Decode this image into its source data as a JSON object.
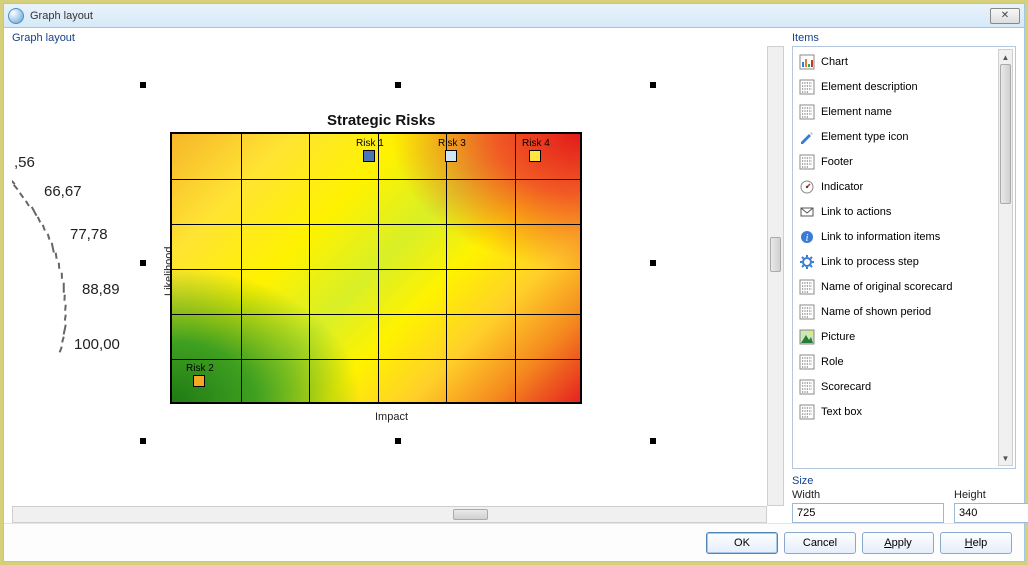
{
  "window": {
    "title": "Graph layout"
  },
  "panel": {
    "label": "Graph layout"
  },
  "gauge": {
    "labels": [
      ",56",
      "66,67",
      "77,78",
      "88,89",
      "100,00"
    ]
  },
  "chart": {
    "title": "Strategic Risks",
    "x_axis": "Impact",
    "y_axis": "Likelihood"
  },
  "chart_data": {
    "type": "heatmap",
    "title": "Strategic Risks",
    "xlabel": "Impact",
    "ylabel": "Likelihood",
    "grid": {
      "cols": 6,
      "rows": 6
    },
    "color_scale": [
      "green",
      "yellow",
      "orange",
      "red"
    ],
    "markers": [
      {
        "name": "Risk 1",
        "col": 3,
        "row": 1,
        "color": "#4a76b8"
      },
      {
        "name": "Risk 3",
        "col": 4,
        "row": 1,
        "color": "#cfe4f5"
      },
      {
        "name": "Risk 4",
        "col": 5.5,
        "row": 1,
        "color": "#ffe640"
      },
      {
        "name": "Risk 2",
        "col": 1,
        "row": 6,
        "color": "#f5a623"
      }
    ]
  },
  "items_panel": {
    "label": "Items",
    "list": [
      {
        "label": "Chart",
        "icon": "chart-icon"
      },
      {
        "label": "Element description",
        "icon": "text-grid-icon"
      },
      {
        "label": "Element name",
        "icon": "text-grid-icon"
      },
      {
        "label": "Element type icon",
        "icon": "pencil-icon"
      },
      {
        "label": "Footer",
        "icon": "text-grid-icon"
      },
      {
        "label": "Indicator",
        "icon": "gauge-icon"
      },
      {
        "label": "Link to actions",
        "icon": "envelope-icon"
      },
      {
        "label": "Link to information items",
        "icon": "info-icon"
      },
      {
        "label": "Link to process step",
        "icon": "gear-icon"
      },
      {
        "label": "Name of original scorecard",
        "icon": "text-grid-icon"
      },
      {
        "label": "Name of shown period",
        "icon": "text-grid-icon"
      },
      {
        "label": "Picture",
        "icon": "picture-icon"
      },
      {
        "label": "Role",
        "icon": "text-grid-icon"
      },
      {
        "label": "Scorecard",
        "icon": "text-grid-icon"
      },
      {
        "label": "Text box",
        "icon": "text-grid-icon"
      }
    ]
  },
  "size_panel": {
    "label": "Size",
    "width_label": "Width",
    "height_label": "Height",
    "width": "725",
    "height": "340"
  },
  "buttons": {
    "ok": "OK",
    "cancel": "Cancel",
    "apply": "Apply",
    "help": "Help"
  }
}
